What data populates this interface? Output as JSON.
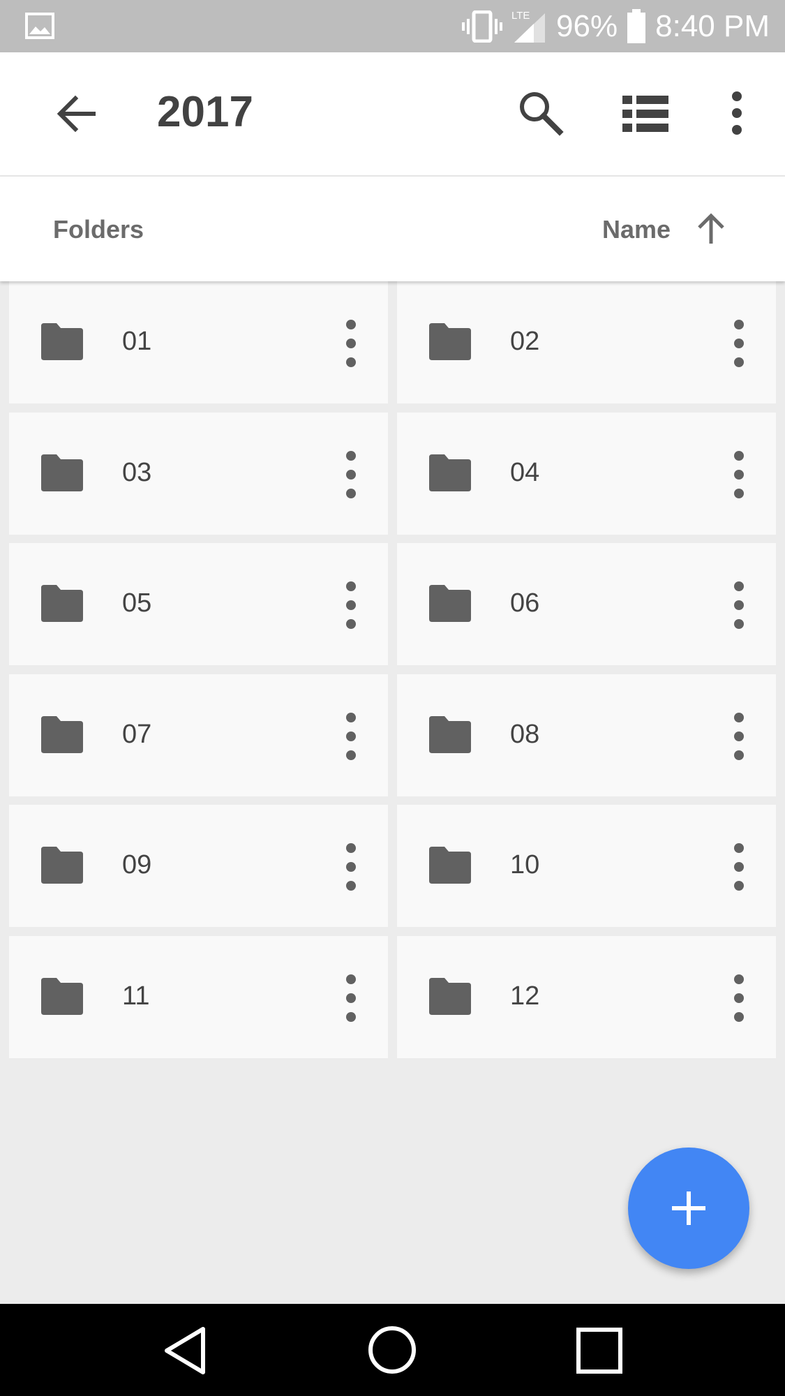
{
  "status_bar": {
    "network": "LTE",
    "battery": "96%",
    "time": "8:40 PM",
    "icons": [
      "image-icon",
      "vibrate-icon",
      "signal-icon",
      "battery-icon"
    ]
  },
  "app_bar": {
    "title": "2017",
    "icons": [
      "back-arrow-icon",
      "search-icon",
      "list-view-icon",
      "more-vert-icon"
    ]
  },
  "sort_bar": {
    "section_label": "Folders",
    "sort_label": "Name",
    "sort_icon": "arrow-up-icon"
  },
  "folders": [
    {
      "name": "01"
    },
    {
      "name": "02"
    },
    {
      "name": "03"
    },
    {
      "name": "04"
    },
    {
      "name": "05"
    },
    {
      "name": "06"
    },
    {
      "name": "07"
    },
    {
      "name": "08"
    },
    {
      "name": "09"
    },
    {
      "name": "10"
    },
    {
      "name": "11"
    },
    {
      "name": "12"
    }
  ],
  "fab": {
    "icon": "plus-icon",
    "color": "#4286f4"
  },
  "nav_bar": {
    "icons": [
      "nav-back-icon",
      "nav-home-icon",
      "nav-recents-icon"
    ]
  },
  "colors": {
    "status_bar": "#bdbdbd",
    "background": "#ececec",
    "card": "#f9f9f9",
    "icon": "#616161",
    "accent": "#4286f4"
  }
}
